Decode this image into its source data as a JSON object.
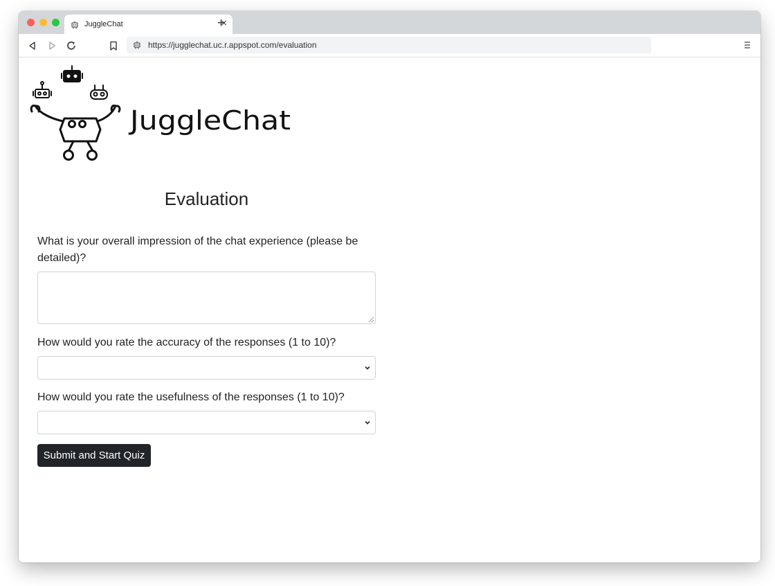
{
  "browser": {
    "tab": {
      "title": "JuggleChat",
      "favicon": "robot-icon",
      "close": "×"
    },
    "new_tab": "+",
    "url": "https://jugglechat.uc.r.appspot.com/evaluation",
    "nav_icons": [
      "back-icon",
      "forward-icon",
      "reload-icon",
      "bookmark-icon"
    ],
    "menu_icon": "menu-icon"
  },
  "brand": {
    "name": "JuggleChat"
  },
  "page": {
    "title": "Evaluation"
  },
  "form": {
    "q1": {
      "label": "What is your overall impression of the chat experience (please be detailed)?",
      "value": ""
    },
    "q2": {
      "label": "How would you rate the accuracy of the responses (1 to 10)?",
      "selected": ""
    },
    "q3": {
      "label": "How would you rate the usefulness of the responses (1 to 10)?",
      "selected": ""
    },
    "submit_label": "Submit and Start Quiz"
  },
  "colors": {
    "button_bg": "#212529",
    "tab_bar": "#d4d7da",
    "traffic_red": "#fe5f57",
    "traffic_yellow": "#febc2e",
    "traffic_green": "#28c840"
  }
}
